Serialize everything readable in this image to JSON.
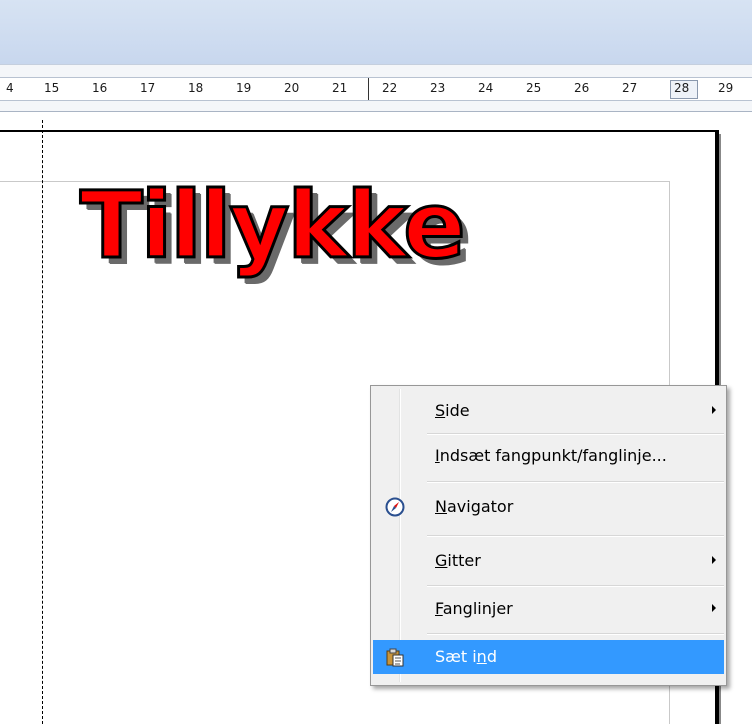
{
  "ruler": {
    "labels": [
      "4",
      "15",
      "16",
      "17",
      "18",
      "19",
      "20",
      "21",
      "22",
      "23",
      "24",
      "25",
      "26",
      "27",
      "28",
      "29"
    ]
  },
  "document": {
    "headline": "Tillykke"
  },
  "context_menu": {
    "items": [
      {
        "label": "Side",
        "mnemonic": "S",
        "rest": "ide",
        "submenu": true
      },
      {
        "label": "Indsæt fangpunkt/fanglinje...",
        "mnemonic": "I",
        "rest": "ndsæt fangpunkt/fanglinje...",
        "submenu": false
      },
      {
        "label": "Navigator",
        "mnemonic": "N",
        "rest": "avigator",
        "submenu": false,
        "icon": "navigator-compass-icon"
      },
      {
        "label": "Gitter",
        "mnemonic": "G",
        "rest": "itter",
        "submenu": true
      },
      {
        "label": "Fanglinjer",
        "mnemonic": "F",
        "rest": "anglinjer",
        "submenu": true
      },
      {
        "label": "Sæt ind",
        "pre": "Sæt i",
        "mnemonic": "n",
        "post": "d",
        "submenu": false,
        "icon": "paste-clipboard-icon",
        "selected": true
      }
    ]
  },
  "colors": {
    "headline_fill": "#ff0000",
    "selection": "#3399ff"
  }
}
